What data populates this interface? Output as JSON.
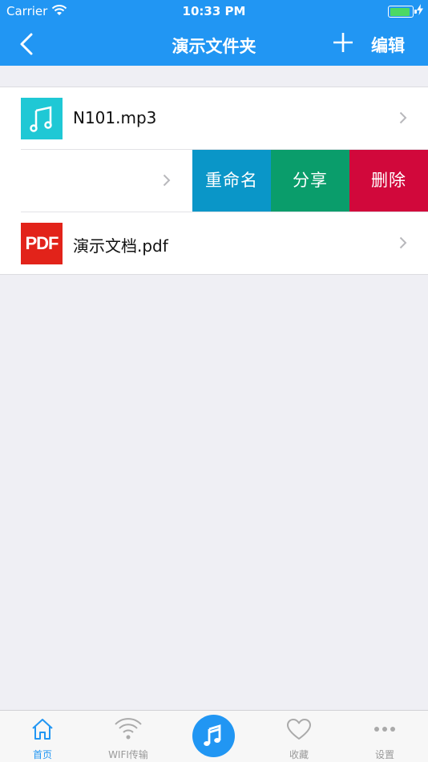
{
  "status_bar": {
    "carrier": "Carrier",
    "time": "10:33 PM"
  },
  "nav": {
    "title": "演示文件夹",
    "edit_label": "编辑"
  },
  "files": [
    {
      "name": "N101.mp3",
      "icon": "music-note-icon"
    },
    {
      "name": "",
      "icon": ""
    },
    {
      "name": "演示文档.pdf",
      "icon": "pdf-icon",
      "icon_text": "PDF"
    }
  ],
  "swipe_actions": {
    "rename": "重命名",
    "share": "分享",
    "delete": "删除"
  },
  "tabs": [
    {
      "label": "首页",
      "icon": "home-icon",
      "active": true
    },
    {
      "label": "WIFI传输",
      "icon": "wifi-icon",
      "active": false
    },
    {
      "label": "",
      "icon": "music-note-icon",
      "active": false
    },
    {
      "label": "收藏",
      "icon": "heart-icon",
      "active": false
    },
    {
      "label": "设置",
      "icon": "more-dots-icon",
      "active": false
    }
  ],
  "colors": {
    "primary": "#2196f3",
    "rename": "#0a96c8",
    "share": "#0a9d6b",
    "delete": "#d1083b",
    "music_icon_bg": "#1fc8d5",
    "pdf_icon_bg": "#e2231a"
  }
}
